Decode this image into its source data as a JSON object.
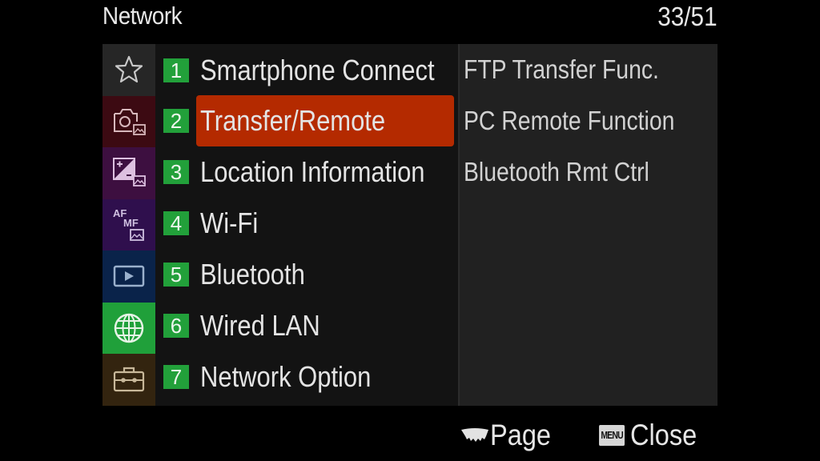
{
  "header": {
    "title": "Network",
    "page_indicator": "33/51"
  },
  "sidebar": {
    "tabs": [
      {
        "icon": "star-icon",
        "name": "my-menu",
        "bg": "#262626",
        "selected": false
      },
      {
        "icon": "camera-image-icon",
        "name": "shooting",
        "bg": "#3c0a12",
        "selected": false
      },
      {
        "icon": "exposure-image-icon",
        "name": "exposure-color",
        "bg": "#3d0f40",
        "selected": false
      },
      {
        "icon": "af-mf-image-icon",
        "name": "focus",
        "bg": "#2f0f4d",
        "selected": false
      },
      {
        "icon": "playback-icon",
        "name": "playback",
        "bg": "#0a234a",
        "selected": false
      },
      {
        "icon": "globe-icon",
        "name": "network",
        "bg": "#20a03a",
        "selected": true
      },
      {
        "icon": "toolbox-icon",
        "name": "setup",
        "bg": "#33240f",
        "selected": false
      }
    ]
  },
  "menu": {
    "items": [
      {
        "number": "1",
        "label": "Smartphone Connect",
        "selected": false
      },
      {
        "number": "2",
        "label": "Transfer/Remote",
        "selected": true
      },
      {
        "number": "3",
        "label": "Location Information",
        "selected": false
      },
      {
        "number": "4",
        "label": "Wi-Fi",
        "selected": false
      },
      {
        "number": "5",
        "label": "Bluetooth",
        "selected": false
      },
      {
        "number": "6",
        "label": "Wired LAN",
        "selected": false
      },
      {
        "number": "7",
        "label": "Network Option",
        "selected": false
      }
    ]
  },
  "submenu": {
    "items": [
      "FTP Transfer Func.",
      "PC Remote Function",
      "Bluetooth Rmt Ctrl"
    ]
  },
  "footer": {
    "page_icon": "dial-icon",
    "page_label": "Page",
    "menu_badge": "MENU",
    "close_label": "Close"
  },
  "colors": {
    "accent_selected": "#b42a00",
    "number_badge": "#22a03a"
  }
}
